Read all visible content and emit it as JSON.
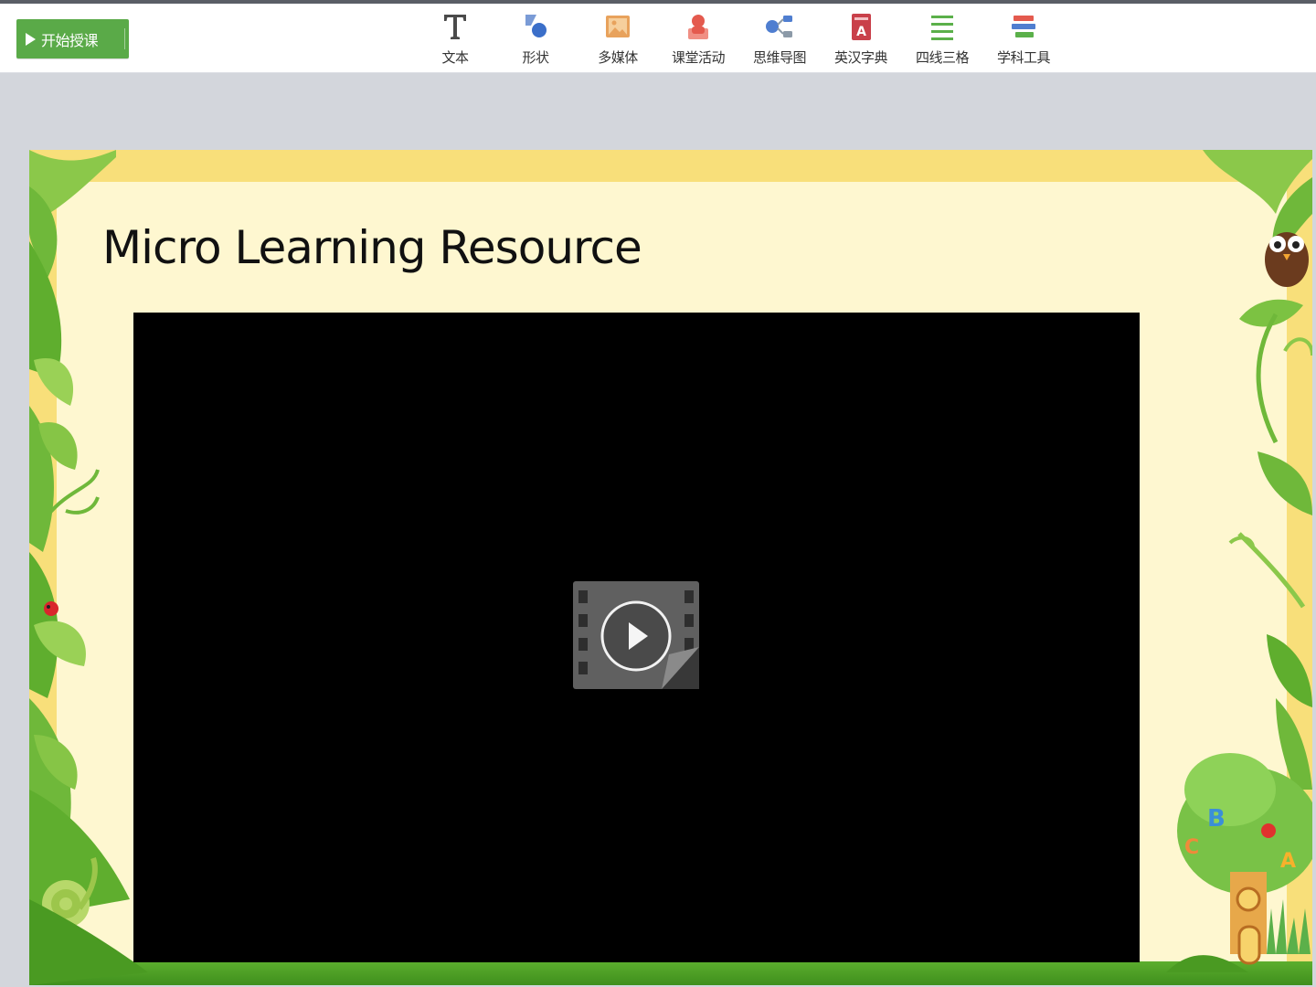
{
  "toolbar": {
    "start_label": "开始授课",
    "tools": [
      {
        "label": "文本",
        "icon": "text-icon"
      },
      {
        "label": "形状",
        "icon": "shape-icon"
      },
      {
        "label": "多媒体",
        "icon": "multimedia-icon"
      },
      {
        "label": "课堂活动",
        "icon": "class-activity-icon"
      },
      {
        "label": "思维导图",
        "icon": "mind-map-icon"
      },
      {
        "label": "英汉字典",
        "icon": "dictionary-icon"
      },
      {
        "label": "四线三格",
        "icon": "four-line-grid-icon"
      },
      {
        "label": "学科工具",
        "icon": "subject-tools-icon"
      }
    ]
  },
  "slide": {
    "title": "Micro Learning Resource"
  },
  "colors": {
    "start_button": "#5aaa48",
    "frame_yellow": "#f8df7a",
    "slide_bg": "#fef7d0",
    "leaf_green": "#7cc242",
    "grass_green": "#4a9a22"
  }
}
